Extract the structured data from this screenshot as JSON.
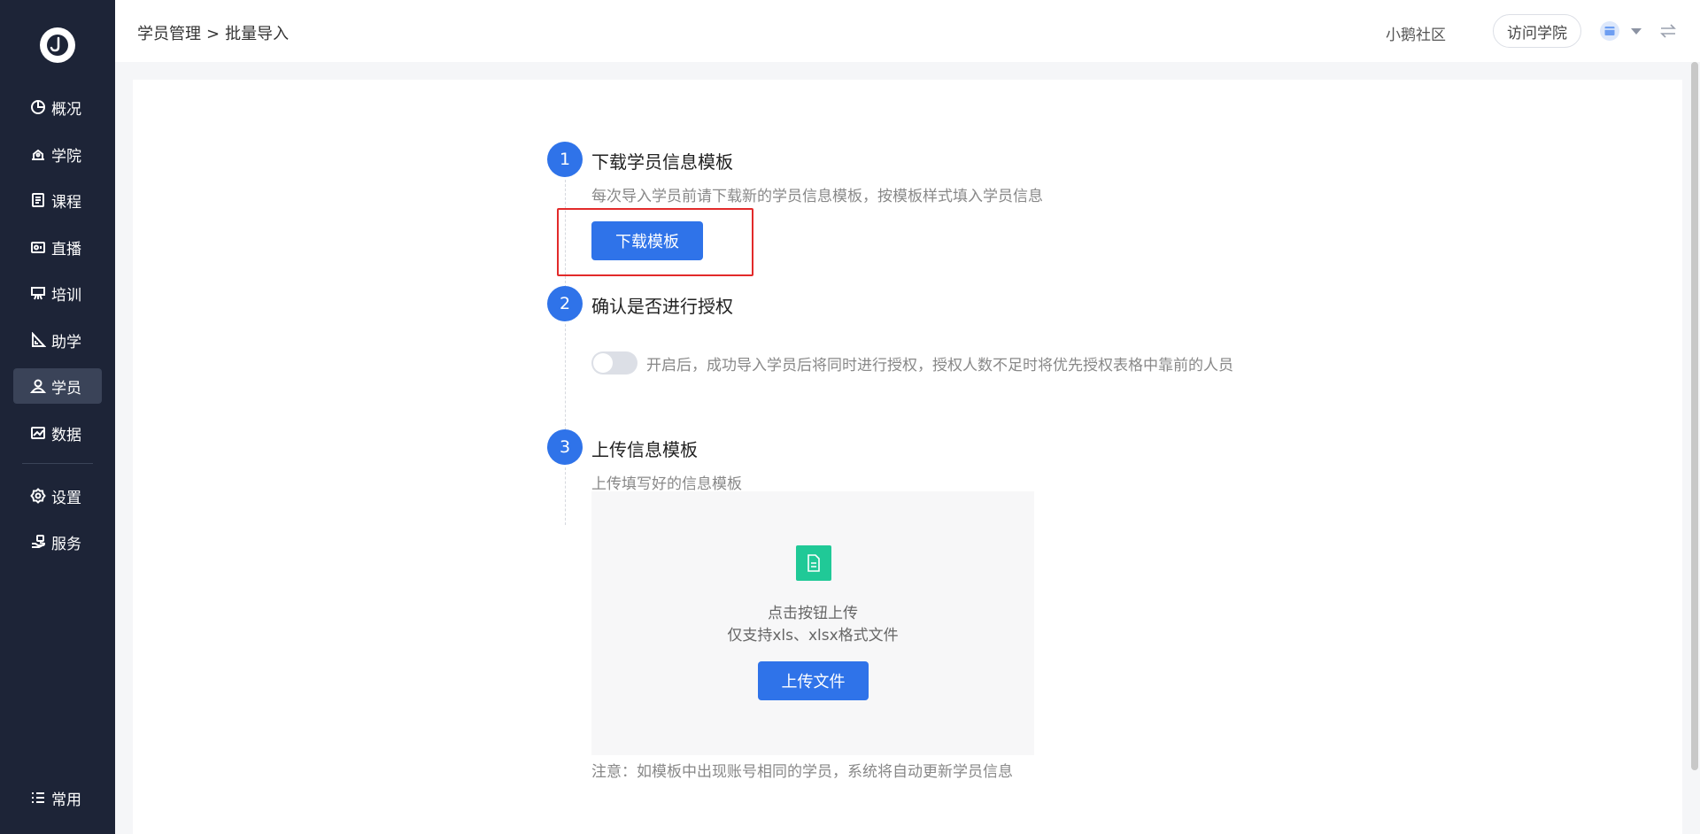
{
  "sidebar": {
    "items": [
      {
        "label": "概况",
        "icon": "pie-chart-icon"
      },
      {
        "label": "学院",
        "icon": "academy-icon"
      },
      {
        "label": "课程",
        "icon": "course-icon"
      },
      {
        "label": "直播",
        "icon": "live-icon"
      },
      {
        "label": "培训",
        "icon": "training-icon"
      },
      {
        "label": "助学",
        "icon": "study-aid-icon"
      },
      {
        "label": "学员",
        "icon": "student-icon",
        "active": true
      },
      {
        "label": "数据",
        "icon": "data-icon"
      },
      {
        "label": "设置",
        "icon": "settings-icon"
      },
      {
        "label": "服务",
        "icon": "service-icon"
      },
      {
        "label": "常用",
        "icon": "favorites-icon"
      }
    ]
  },
  "header": {
    "breadcrumb_parent": "学员管理",
    "breadcrumb_separator": ">",
    "breadcrumb_current": "批量导入",
    "community": "小鹅社区",
    "visit_button": "访问学院"
  },
  "steps": {
    "step1": {
      "num": "1",
      "title": "下载学员信息模板",
      "desc": "每次导入学员前请下载新的学员信息模板，按模板样式填入学员信息",
      "button": "下载模板"
    },
    "step2": {
      "num": "2",
      "title": "确认是否进行授权",
      "toggle_text": "开启后，成功导入学员后将同时进行授权，授权人数不足时将优先授权表格中靠前的人员"
    },
    "step3": {
      "num": "3",
      "title": "上传信息模板",
      "desc": "上传填写好的信息模板",
      "upload_hint": "点击按钮上传",
      "upload_format": "仅支持xls、xlsx格式文件",
      "upload_button": "上传文件",
      "note": "注意：如模板中出现账号相同的学员，系统将自动更新学员信息"
    }
  },
  "colors": {
    "primary": "#2f73e9",
    "sidebar_bg": "#1d2437",
    "sidebar_active": "#3a4358",
    "file_icon": "#20c997",
    "highlight": "#e22a2a"
  }
}
